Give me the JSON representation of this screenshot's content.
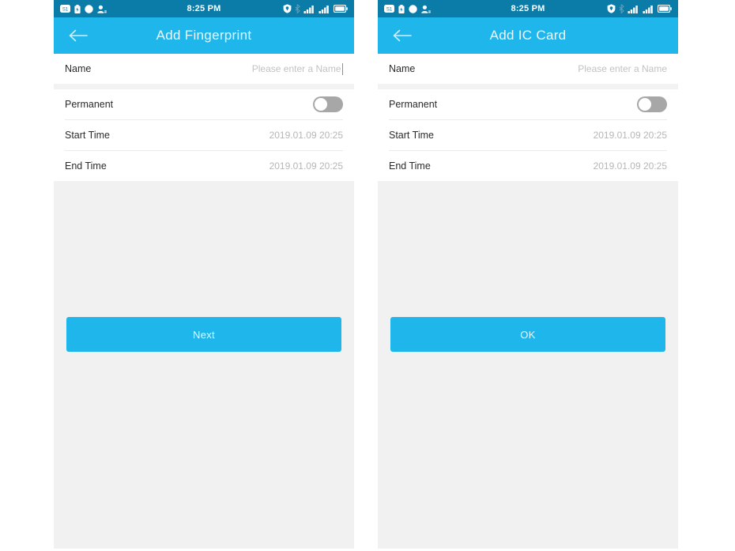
{
  "screens": [
    {
      "id": "add-fingerprint",
      "status_bar": {
        "clock": "8:25 PM",
        "left_icons": [
          "sim-icon",
          "battery-saver-icon",
          "circle-icon",
          "contact-icon"
        ],
        "right_icons": [
          "shield-icon",
          "bluetooth-icon",
          "signal-bars-1-icon",
          "signal-bars-2-icon",
          "battery-icon"
        ]
      },
      "title": "Add Fingerprint",
      "back_icon": "back-arrow-icon",
      "rows": {
        "name": {
          "label": "Name",
          "placeholder": "Please enter a Name",
          "value": "",
          "caret": true
        },
        "permanent": {
          "label": "Permanent",
          "toggle_on": false
        },
        "start_time": {
          "label": "Start Time",
          "value": "2019.01.09 20:25"
        },
        "end_time": {
          "label": "End Time",
          "value": "2019.01.09 20:25"
        }
      },
      "primary_button": "Next"
    },
    {
      "id": "add-ic-card",
      "status_bar": {
        "clock": "8:25 PM",
        "left_icons": [
          "sim-icon",
          "battery-saver-icon",
          "circle-icon",
          "contact-icon"
        ],
        "right_icons": [
          "shield-icon",
          "bluetooth-icon",
          "signal-bars-1-icon",
          "signal-bars-2-icon",
          "battery-icon"
        ]
      },
      "title": "Add IC Card",
      "back_icon": "back-arrow-icon",
      "rows": {
        "name": {
          "label": "Name",
          "placeholder": "Please enter a Name",
          "value": "",
          "caret": false
        },
        "permanent": {
          "label": "Permanent",
          "toggle_on": false
        },
        "start_time": {
          "label": "Start Time",
          "value": "2019.01.09 20:25"
        },
        "end_time": {
          "label": "End Time",
          "value": "2019.01.09 20:25"
        }
      },
      "primary_button": "OK"
    }
  ],
  "colors": {
    "status_bar": "#0b7ba8",
    "title_bar": "#1fb6ec",
    "accent": "#1fb6ec",
    "body": "#f1f1f1",
    "label": "#2b2b2b",
    "value": "#b6b6b6"
  }
}
